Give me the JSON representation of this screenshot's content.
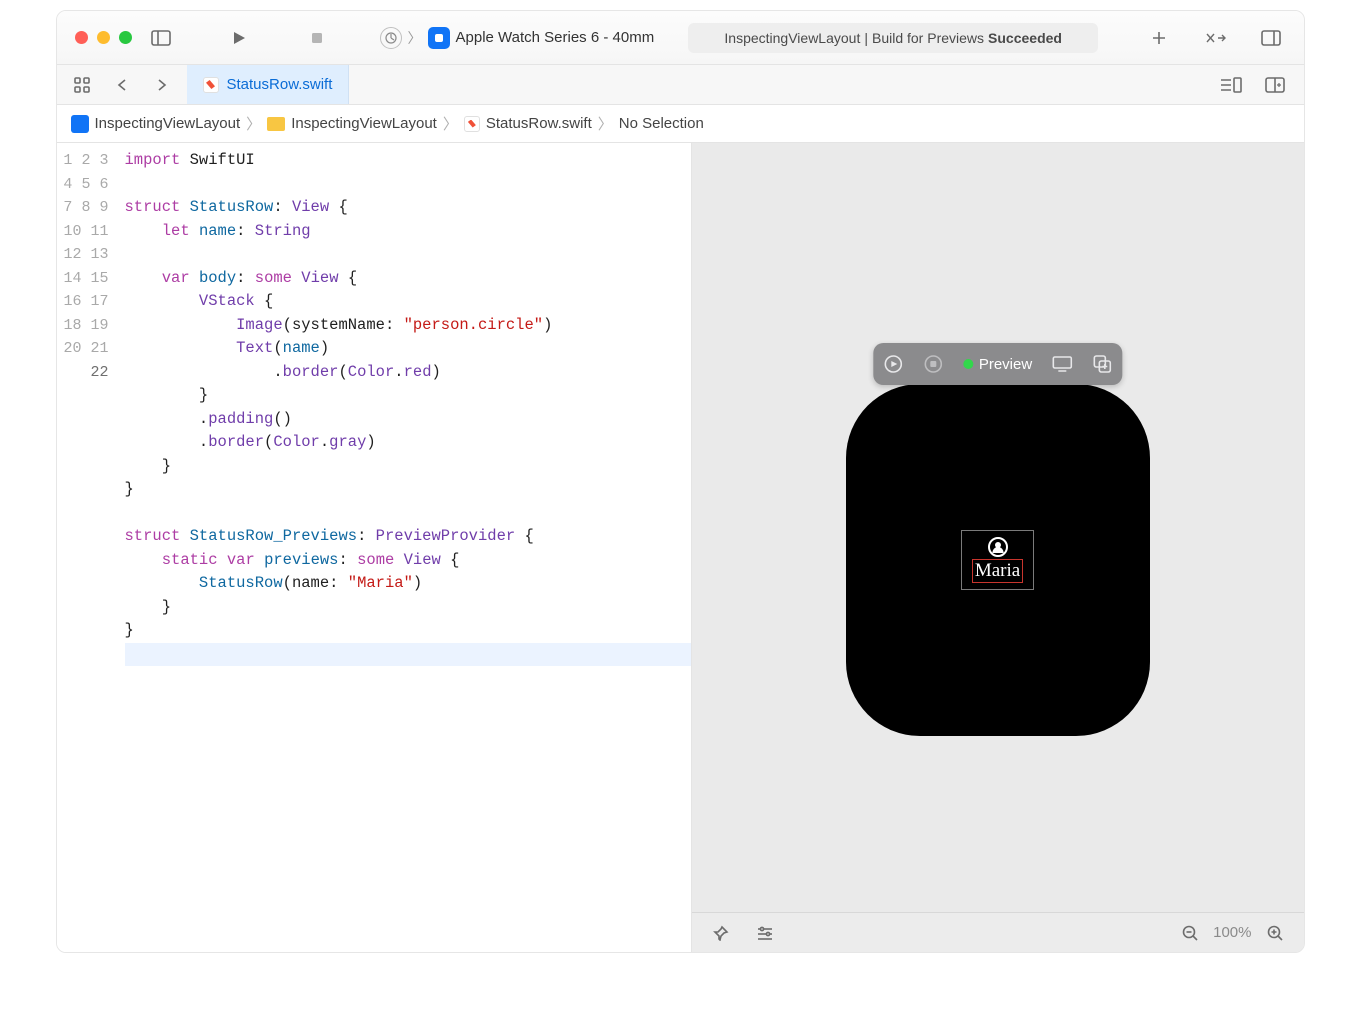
{
  "scheme": {
    "device": "Apple Watch Series 6 - 40mm"
  },
  "status": {
    "project": "InspectingViewLayout",
    "action": "Build for Previews",
    "result": "Succeeded"
  },
  "tab": {
    "filename": "StatusRow.swift"
  },
  "path": {
    "project": "InspectingViewLayout",
    "folder": "InspectingViewLayout",
    "file": "StatusRow.swift",
    "selection": "No Selection"
  },
  "code": {
    "systemNameStr": "\"person.circle\"",
    "mariaStr": "\"Maria\"",
    "structName1": "StatusRow",
    "structName2": "StatusRow_Previews",
    "typeString": "String",
    "typeView": "View",
    "typeColor": "Color",
    "previewProvider": "PreviewProvider"
  },
  "preview": {
    "toolbarLabel": "Preview",
    "textValue": "Maria"
  },
  "footer": {
    "zoom": "100%"
  },
  "lineNumbers": [
    "1",
    "2",
    "3",
    "4",
    "5",
    "6",
    "7",
    "8",
    "9",
    "10",
    "11",
    "12",
    "13",
    "14",
    "15",
    "16",
    "17",
    "18",
    "19",
    "20",
    "21",
    "22"
  ]
}
